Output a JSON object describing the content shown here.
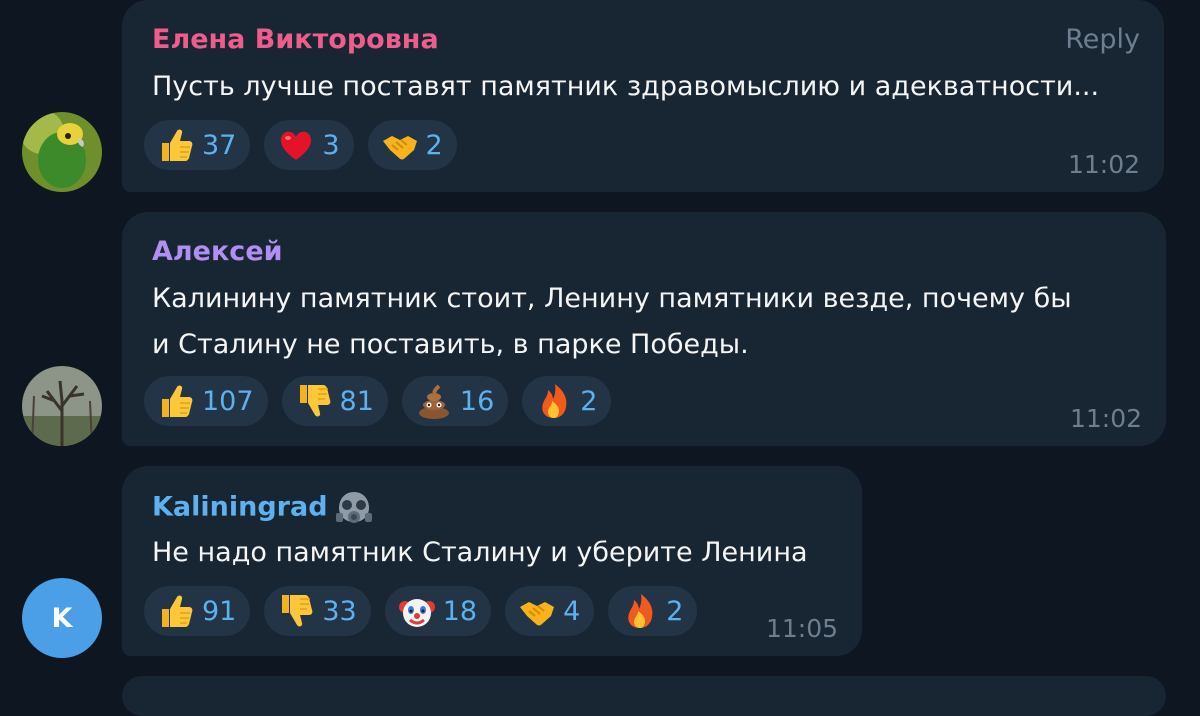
{
  "messages": [
    {
      "author": "Елена Викторовна",
      "author_color": "#ee5d8c",
      "reply_label": "Reply",
      "lines": [
        "Пусть лучше поставят памятник здравомыслию и адекватности..."
      ],
      "reactions": [
        {
          "icon": "thumbs-up-icon",
          "count": "37"
        },
        {
          "icon": "red-heart-icon",
          "count": "3"
        },
        {
          "icon": "handshake-icon",
          "count": "2"
        }
      ],
      "time": "11:02",
      "avatar": "parrot-avatar"
    },
    {
      "author": "Алексей",
      "author_color": "#b08ef2",
      "lines": [
        "Калинину памятник стоит, Ленину памятники везде,  почему бы",
        "и Сталину не поставить, в парке Победы."
      ],
      "reactions": [
        {
          "icon": "thumbs-up-icon",
          "count": "107"
        },
        {
          "icon": "thumbs-down-icon",
          "count": "81"
        },
        {
          "icon": "pile-of-poo-icon",
          "count": "16"
        },
        {
          "icon": "fire-icon",
          "count": "2"
        }
      ],
      "time": "11:02",
      "avatar": "tree-avatar"
    },
    {
      "author": "Kaliningrad",
      "author_color": "#5fb0ee",
      "author_icon": "gas-mask-icon",
      "lines": [
        "Не надо памятник Сталину и уберите Ленина"
      ],
      "reactions": [
        {
          "icon": "thumbs-up-icon",
          "count": "91"
        },
        {
          "icon": "thumbs-down-icon",
          "count": "33"
        },
        {
          "icon": "clown-face-icon",
          "count": "18"
        },
        {
          "icon": "handshake-icon",
          "count": "4"
        },
        {
          "icon": "fire-icon",
          "count": "2"
        }
      ],
      "time": "11:05",
      "avatar_letter": "K",
      "avatar_color": "#4a9fe6"
    }
  ]
}
